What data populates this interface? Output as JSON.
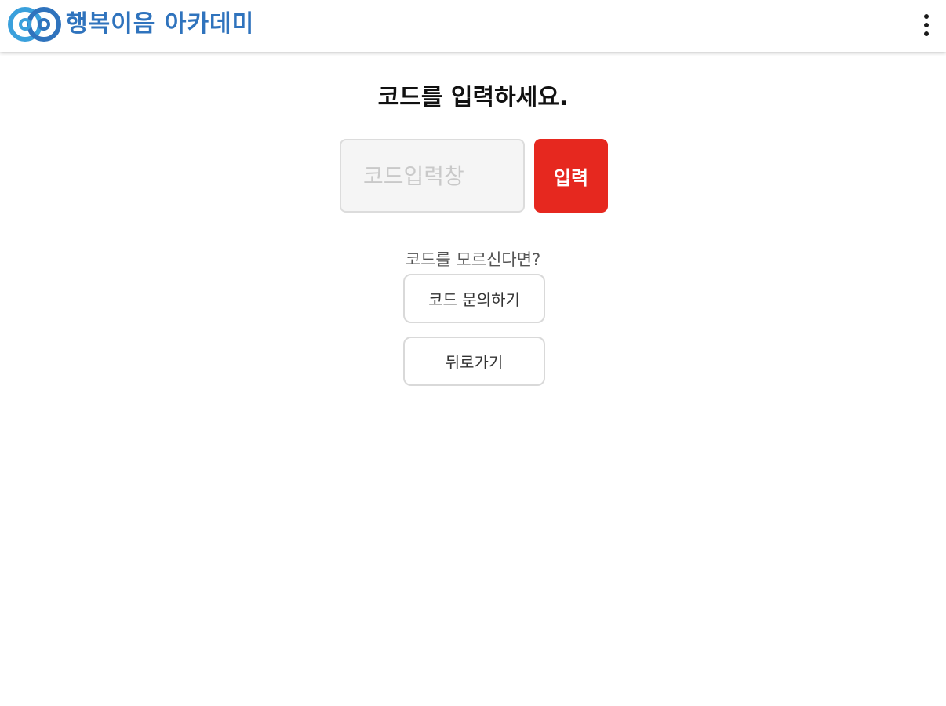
{
  "header": {
    "logo_text": "행복이음 아카데미",
    "logo_icon": "logo-double-circle-icon",
    "menu_icon": "more-vertical-icon",
    "brand_color": "#2f73bd"
  },
  "main": {
    "title": "코드를 입력하세요.",
    "code_input": {
      "value": "",
      "placeholder": "코드입력창"
    },
    "submit_label": "입력",
    "submit_color": "#e6281f",
    "help_text": "코드를 모르신다면?",
    "inquiry_label": "코드 문의하기",
    "back_label": "뒤로가기"
  }
}
